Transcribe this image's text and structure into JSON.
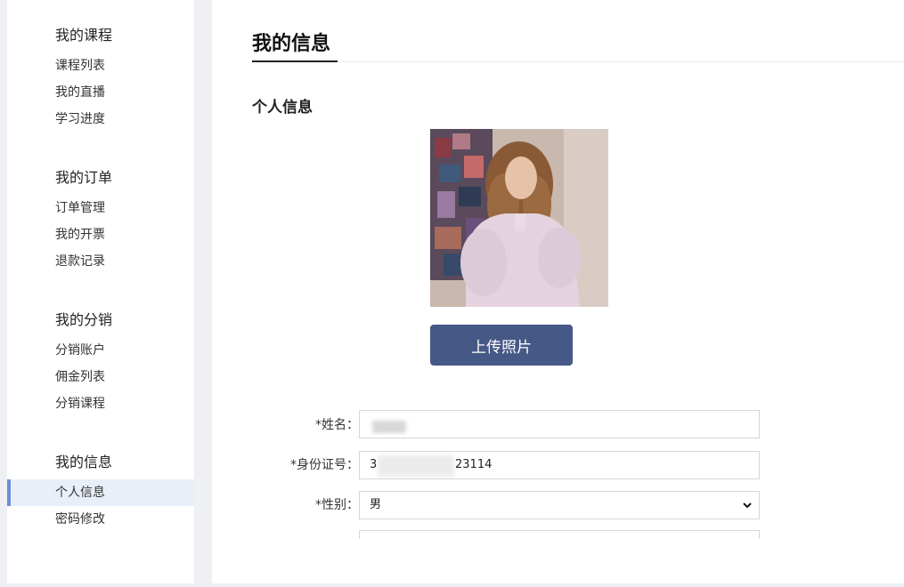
{
  "sidebar": {
    "groups": [
      {
        "title": "我的课程",
        "items": [
          "课程列表",
          "我的直播",
          "学习进度"
        ]
      },
      {
        "title": "我的订单",
        "items": [
          "订单管理",
          "我的开票",
          "退款记录"
        ]
      },
      {
        "title": "我的分销",
        "items": [
          "分销账户",
          "佣金列表",
          "分销课程"
        ]
      },
      {
        "title": "我的信息",
        "items": [
          "个人信息",
          "密码修改"
        ]
      }
    ],
    "active_item": "个人信息",
    "accent_color": "#6d8fd1"
  },
  "main": {
    "page_title": "我的信息",
    "section_title": "个人信息",
    "upload_button": "上传照片",
    "form": {
      "name_label": "*姓名：",
      "name_value": "",
      "id_label": "*身份证号：",
      "id_value_prefix": "3",
      "id_value_suffix": "23114",
      "gender_label": "*性别：",
      "gender_value": "男"
    },
    "button_color": "#465885"
  }
}
